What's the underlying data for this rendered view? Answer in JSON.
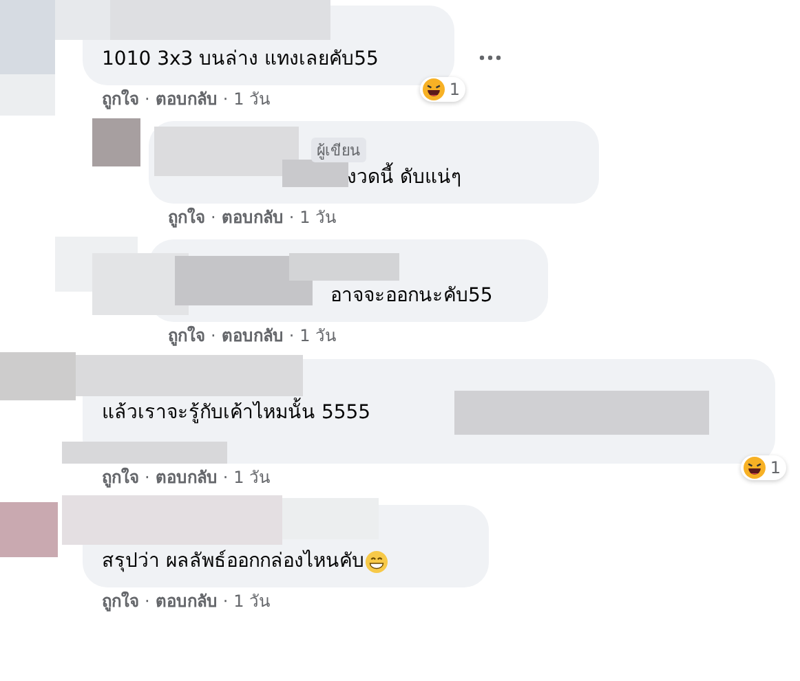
{
  "separator": "·",
  "comments": [
    {
      "kind": "comment",
      "text": "1010 3x3 บนล่าง แทงเลยคับ55",
      "reaction_count": "1",
      "menu": true,
      "actions": [
        "ถูกใจ",
        "ตอบกลับ",
        "1 วัน"
      ]
    },
    {
      "kind": "reply",
      "author_badge": "ผู้เขียน",
      "text": "งวดนี้ ดับแน่ๆ",
      "actions": [
        "ถูกใจ",
        "ตอบกลับ",
        "1 วัน"
      ]
    },
    {
      "kind": "reply",
      "text": "อาจจะออกนะคับ55",
      "actions": [
        "ถูกใจ",
        "ตอบกลับ",
        "1 วัน"
      ]
    },
    {
      "kind": "comment",
      "text": "แล้วเราจะรู้กับเค้าไหมนั้น 5555",
      "reaction_count": "1",
      "actions": [
        "ถูกใจ",
        "ตอบกลับ",
        "1 วัน"
      ]
    },
    {
      "kind": "comment",
      "text": "สรุปว่า ผลลัพธ์ออกกล่องไหนคับ",
      "grin_emoji": true,
      "actions": [
        "ถูกใจ",
        "ตอบกลับ",
        "1 วัน"
      ]
    }
  ]
}
